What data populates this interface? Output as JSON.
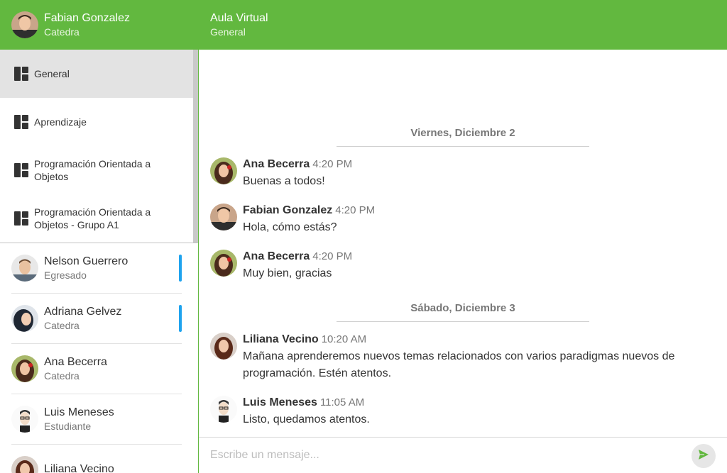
{
  "colors": {
    "accent": "#62b83f",
    "unread": "#1fa3ee",
    "active_channel": "#e3e3e3"
  },
  "user": {
    "name": "Fabian Gonzalez",
    "role": "Catedra",
    "avatar": "avatar-fabian"
  },
  "header": {
    "title": "Aula Virtual",
    "subtitle": "General"
  },
  "channels": [
    {
      "label": "General",
      "icon": "dashboard-icon",
      "active": true
    },
    {
      "label": "Aprendizaje",
      "icon": "dashboard-icon"
    },
    {
      "label": "Programación Orientada a Objetos",
      "icon": "dashboard-icon"
    },
    {
      "label": "Programación Orientada a Objetos - Grupo A1",
      "icon": "dashboard-icon"
    }
  ],
  "contacts": [
    {
      "name": "Nelson Guerrero",
      "role": "Egresado",
      "unread": true
    },
    {
      "name": "Adriana Gelvez",
      "role": "Catedra",
      "unread": true
    },
    {
      "name": "Ana Becerra",
      "role": "Catedra",
      "unread": false
    },
    {
      "name": "Luis Meneses",
      "role": "Estudiante",
      "unread": false
    },
    {
      "name": "Liliana Vecino",
      "role": "",
      "unread": false
    }
  ],
  "chat": {
    "days": [
      {
        "label": "Viernes, Diciembre 2"
      },
      {
        "label": "Sábado, Diciembre 3"
      }
    ],
    "messages": [
      {
        "author": "Ana Becerra",
        "time": "4:20 PM",
        "text": "Buenas a todos!"
      },
      {
        "author": "Fabian Gonzalez",
        "time": "4:20 PM",
        "text": "Hola, cómo estás?"
      },
      {
        "author": "Ana Becerra",
        "time": "4:20 PM",
        "text": "Muy bien, gracias"
      },
      {
        "author": "Liliana Vecino",
        "time": "10:20 AM",
        "text": "Mañana aprenderemos nuevos temas relacionados con varios paradigmas nuevos de programación. Estén atentos."
      },
      {
        "author": "Luis Meneses",
        "time": "11:05 AM",
        "text": "Listo, quedamos atentos."
      }
    ]
  },
  "composer": {
    "placeholder": "Escribe un mensaje...",
    "value": "",
    "send_icon": "send-icon"
  }
}
